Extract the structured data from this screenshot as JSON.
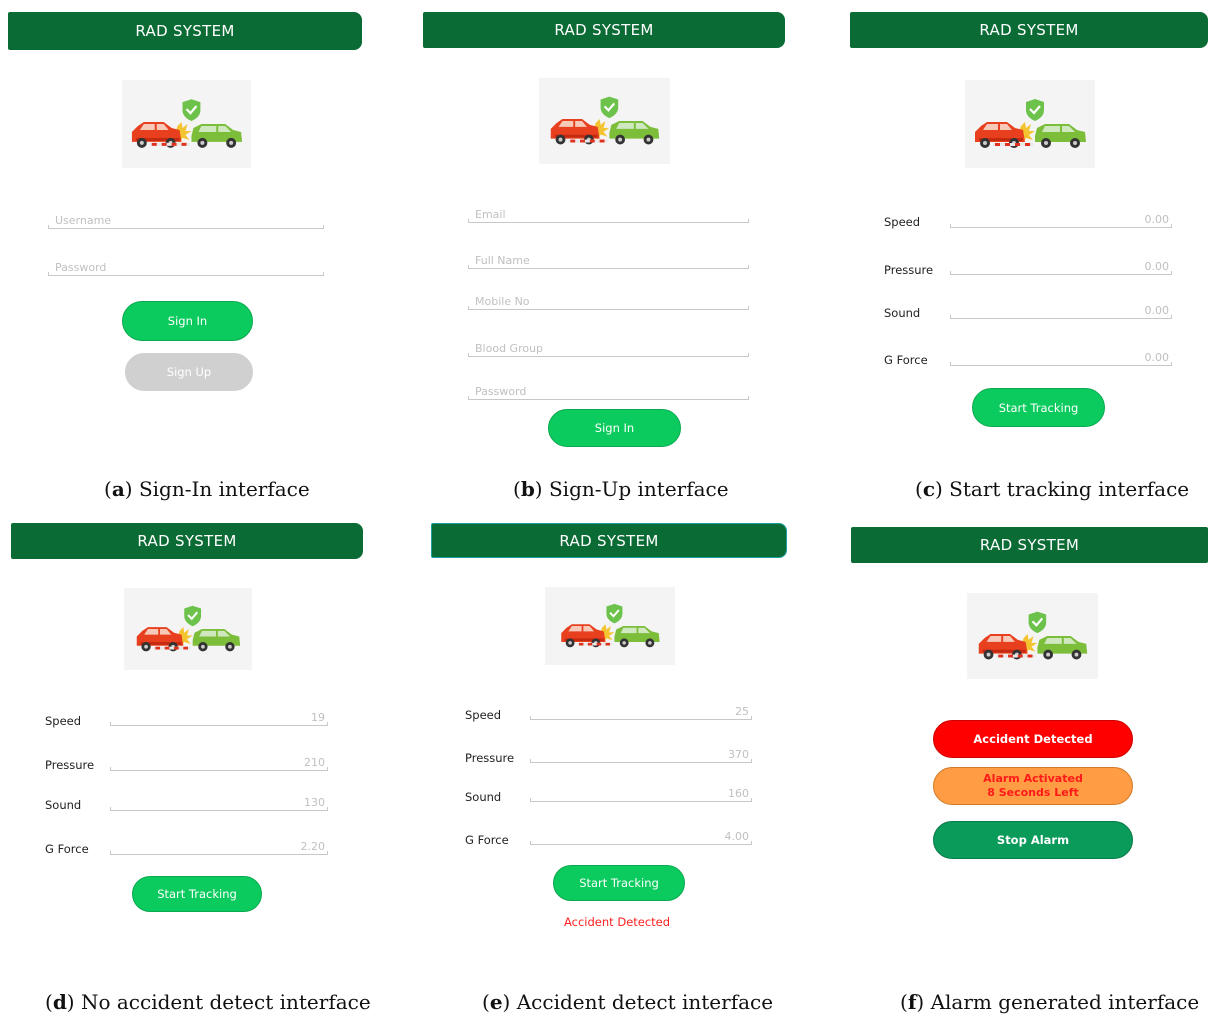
{
  "app_title": "RAD SYSTEM",
  "colors": {
    "title_bar": "#0b6b35",
    "primary_button": "#0bcb5e",
    "alert_red": "#ff0000",
    "alert_orange": "#ff9c44",
    "stop_green": "#0a9a5a"
  },
  "logo_icon": "car-crash-shield-icon",
  "panel_a": {
    "caption_letter": "a",
    "caption_text": "Sign-In interface",
    "username_placeholder": "Username",
    "password_placeholder": "Password",
    "sign_in": "Sign In",
    "sign_up": "Sign Up"
  },
  "panel_b": {
    "caption_letter": "b",
    "caption_text": "Sign-Up interface",
    "email_placeholder": "Email",
    "fullname_placeholder": "Full Name",
    "mobile_placeholder": "Mobile No",
    "blood_placeholder": "Blood Group",
    "password_placeholder": "Password",
    "sign_in": "Sign In"
  },
  "panel_c": {
    "caption_letter": "c",
    "caption_text": "Start tracking interface",
    "labels": [
      "Speed",
      "Pressure",
      "Sound",
      "G Force"
    ],
    "values": [
      "0.00",
      "0.00",
      "0.00",
      "0.00"
    ],
    "start_tracking": "Start Tracking"
  },
  "panel_d": {
    "caption_letter": "d",
    "caption_text": "No accident detect interface",
    "labels": [
      "Speed",
      "Pressure",
      "Sound",
      "G Force"
    ],
    "values": [
      "19",
      "210",
      "130",
      "2.20"
    ],
    "start_tracking": "Start Tracking"
  },
  "panel_e": {
    "caption_letter": "e",
    "caption_text": "Accident detect interface",
    "labels": [
      "Speed",
      "Pressure",
      "Sound",
      "G Force"
    ],
    "values": [
      "25",
      "370",
      "160",
      "4.00"
    ],
    "start_tracking": "Start Tracking",
    "status": "Accident Detected"
  },
  "panel_f": {
    "caption_letter": "f",
    "caption_text": "Alarm generated interface",
    "accident_detected": "Accident Detected",
    "alarm_line1": "Alarm Activated",
    "alarm_line2": "8 Seconds Left",
    "stop_alarm": "Stop Alarm"
  }
}
